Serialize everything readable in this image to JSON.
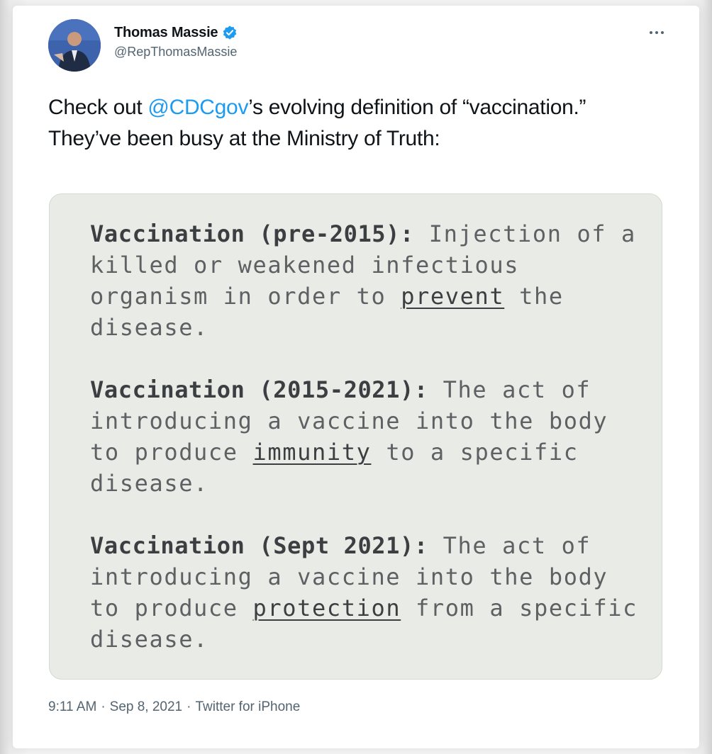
{
  "author": {
    "display_name": "Thomas Massie",
    "handle": "@RepThomasMassie",
    "verified": true,
    "verified_color": "#1d9bf0"
  },
  "tweet": {
    "text_before_mention": "Check out ",
    "mention": "@CDCgov",
    "text_after_mention": "’s evolving definition of “vaccination.” They’ve been busy at the Ministry of Truth:"
  },
  "media": {
    "definitions": [
      {
        "term": "Vaccination (pre-2015):",
        "text_before": " Injection of a killed or weakened infectious organism in order to ",
        "key_word": "prevent",
        "text_after": " the disease."
      },
      {
        "term": "Vaccination (2015-2021):",
        "text_before": " The act of introducing a vaccine into the body to produce ",
        "key_word": "immunity",
        "text_after": " to a specific disease."
      },
      {
        "term": "Vaccination (Sept 2021):",
        "text_before": " The act of introducing a vaccine into the body to produce ",
        "key_word": "protection",
        "text_after": " from a specific disease."
      }
    ]
  },
  "footer": {
    "time": "9:11 AM",
    "separator": "·",
    "date": "Sep 8, 2021",
    "source": "Twitter for iPhone"
  },
  "icons": {
    "more": "more-icon",
    "verified": "verified-badge-icon"
  }
}
